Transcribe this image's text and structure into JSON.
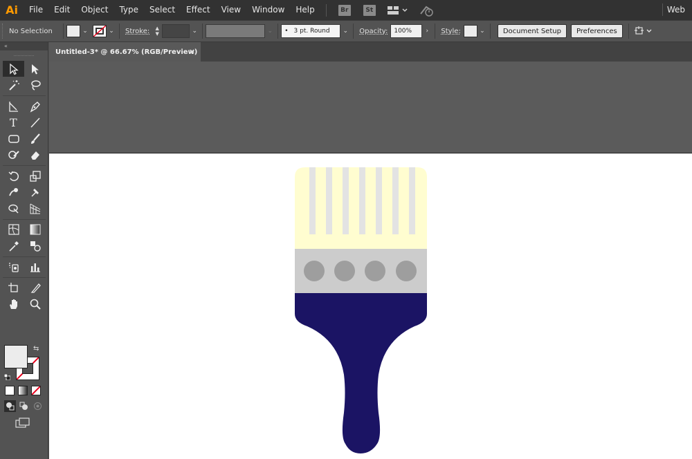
{
  "app": {
    "logo": "Ai",
    "workspace": "Web"
  },
  "menu": [
    "File",
    "Edit",
    "Object",
    "Type",
    "Select",
    "Effect",
    "View",
    "Window",
    "Help"
  ],
  "app_buttons": {
    "bridge": "Br",
    "stock": "St"
  },
  "control": {
    "selection": "No Selection",
    "stroke_label": "Stroke:",
    "brush_value": "3 pt. Round",
    "opacity_label": "Opacity:",
    "opacity_value": "100%",
    "style_label": "Style:",
    "document_setup": "Document Setup",
    "preferences": "Preferences"
  },
  "document": {
    "tab_title": "Untitled-3* @ 66.67% (RGB/Preview)",
    "close": "×"
  },
  "colors": {
    "bristles": "#fffdd0",
    "bristle_lines": "#e3e3e3",
    "ferrule": "#cccccc",
    "rivets": "#9e9e9e",
    "handle": "#1b1464",
    "fill_swatch": "#ececec",
    "stroke_none": "#e8001c"
  },
  "tools": [
    [
      "selection-tool",
      "direct-selection-tool"
    ],
    [
      "magic-wand-tool",
      "lasso-tool"
    ],
    [
      "pen-curvature-tool",
      "pen-tool"
    ],
    [
      "type-tool",
      "line-segment-tool"
    ],
    [
      "rectangle-tool",
      "paintbrush-tool"
    ],
    [
      "shaper-tool",
      "eraser-tool"
    ],
    [
      "rotate-tool",
      "scale-tool"
    ],
    [
      "warp-tool",
      "puppet-warp-tool"
    ],
    [
      "shape-builder-tool",
      "perspective-grid-tool"
    ],
    [
      "mesh-tool",
      "gradient-tool"
    ],
    [
      "eyedropper-tool",
      "blend-tool"
    ],
    [
      "symbol-sprayer-tool",
      "column-graph-tool"
    ],
    [
      "artboard-tool",
      "slice-tool"
    ],
    [
      "hand-tool",
      "zoom-tool"
    ]
  ]
}
